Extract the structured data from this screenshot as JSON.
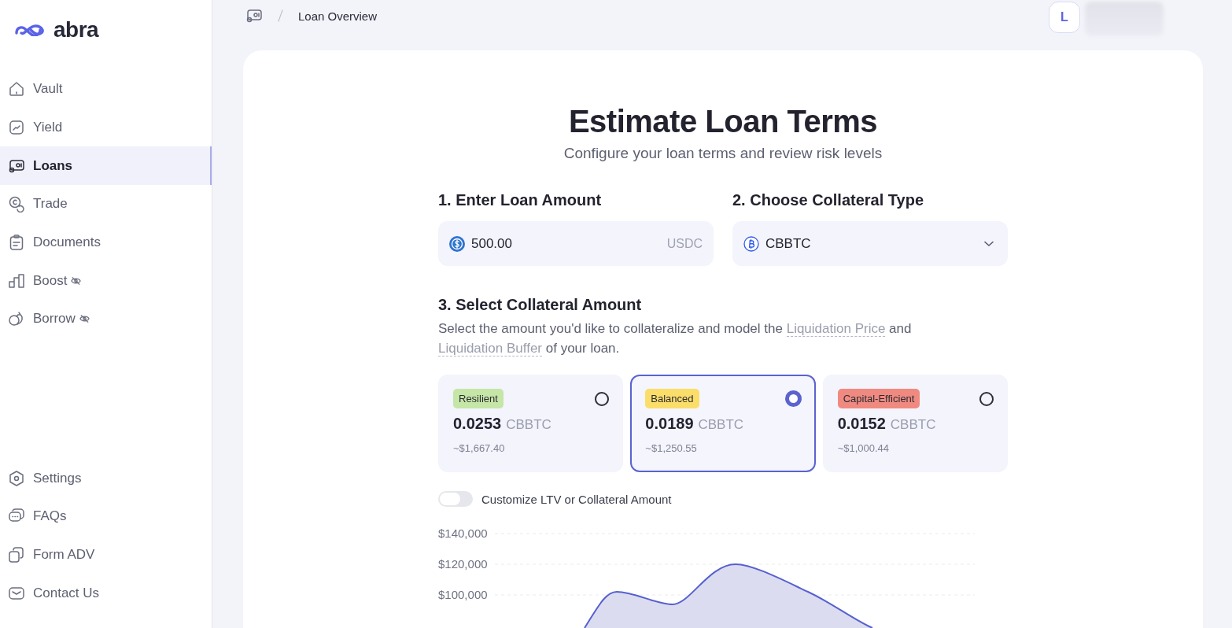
{
  "logo": {
    "text": "abra"
  },
  "sidebar": {
    "items": [
      {
        "label": "Vault",
        "selected": false,
        "hidden": false
      },
      {
        "label": "Yield",
        "selected": false,
        "hidden": false
      },
      {
        "label": "Loans",
        "selected": true,
        "hidden": false
      },
      {
        "label": "Trade",
        "selected": false,
        "hidden": false
      },
      {
        "label": "Documents",
        "selected": false,
        "hidden": false
      },
      {
        "label": "Boost",
        "selected": false,
        "hidden": true
      },
      {
        "label": "Borrow",
        "selected": false,
        "hidden": true
      }
    ],
    "bottom_items": [
      {
        "label": "Settings"
      },
      {
        "label": "FAQs"
      },
      {
        "label": "Form ADV"
      },
      {
        "label": "Contact Us"
      }
    ]
  },
  "breadcrumb": {
    "current": "Loan Overview"
  },
  "user": {
    "initial": "L"
  },
  "title": "Estimate Loan Terms",
  "subtitle": "Configure your loan terms and review risk levels",
  "loan_amount": {
    "heading": "1. Enter Loan Amount",
    "value": "500.00",
    "currency": "USDC"
  },
  "collateral_type": {
    "heading": "2. Choose Collateral Type",
    "value": "CBBTC"
  },
  "collateral_amount": {
    "heading": "3. Select Collateral Amount",
    "description": "Select the amount you'd like to collateralize and model the",
    "link_1": "Liquidation Price",
    "joiner": "and",
    "link_2": "Liquidation Buffer",
    "ending": "of your loan."
  },
  "options": [
    {
      "tag": "Resilient",
      "color": "#c5e6a6",
      "amount": "0.0253",
      "unit": "CBBTC",
      "usd": "~$1,667.40",
      "selected": false
    },
    {
      "tag": "Balanced",
      "color": "#fbdd6a",
      "amount": "0.0189",
      "unit": "CBBTC",
      "usd": "~$1,250.55",
      "selected": true
    },
    {
      "tag": "Capital-Efficient",
      "color": "#f08a80",
      "amount": "0.0152",
      "unit": "CBBTC",
      "usd": "~$1,000.44",
      "selected": false
    }
  ],
  "customize_toggle": {
    "label": "Customize LTV or Collateral Amount",
    "on": false
  },
  "chart": {
    "y_tick_labels": [
      "$140,000",
      "$120,000",
      "$100,000"
    ]
  }
}
